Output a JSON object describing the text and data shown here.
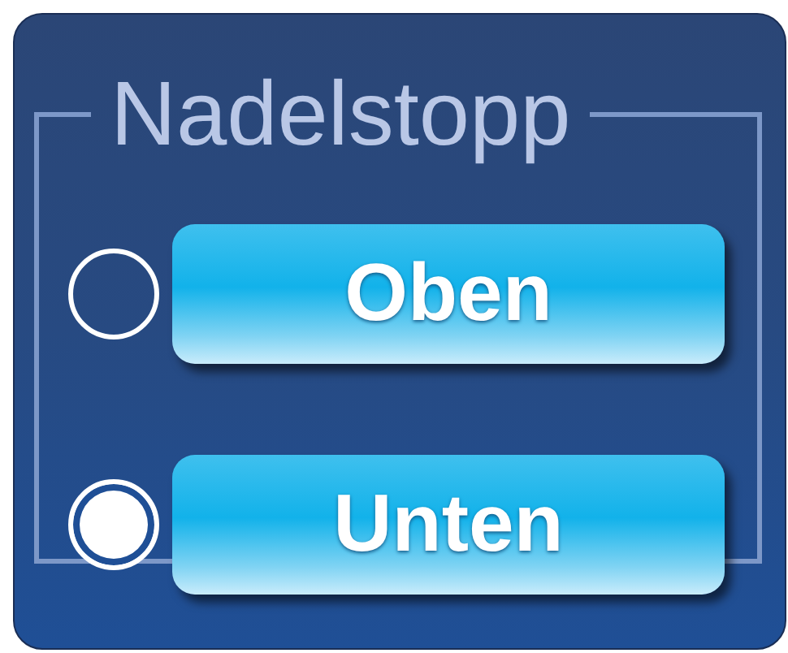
{
  "group": {
    "title": "Nadelstopp"
  },
  "options": [
    {
      "label": "Oben",
      "selected": false
    },
    {
      "label": "Unten",
      "selected": true
    }
  ]
}
